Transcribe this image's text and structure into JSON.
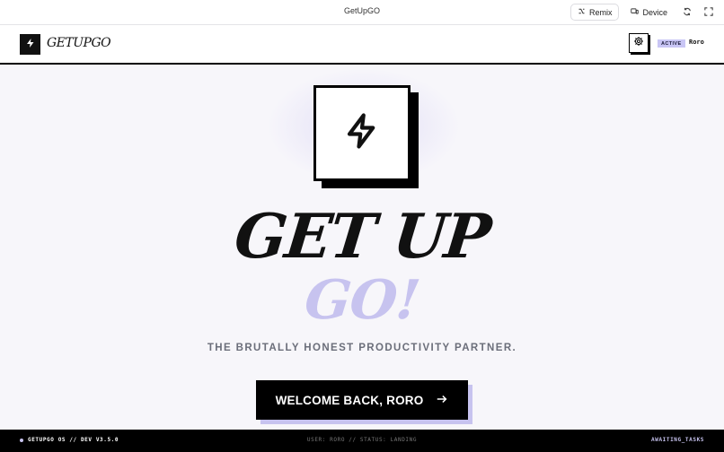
{
  "window": {
    "title": "GetUpGO",
    "remix_label": "Remix",
    "device_label": "Device"
  },
  "header": {
    "logo_text": "GETUPGO",
    "badge": "ACTIVE",
    "user": "Roro"
  },
  "hero": {
    "title": "GET UP",
    "subtitle": "GO!",
    "tagline": "THE BRUTALLY HONEST PRODUCTIVITY PARTNER.",
    "cta_label": "WELCOME BACK, RORO"
  },
  "footer": {
    "left": "GETUPGO OS // DEV V3.5.0",
    "middle": "USER: RORO // STATUS: LANDING",
    "right": "AWAITING_TASKS"
  },
  "colors": {
    "accent": "#c7c3ef",
    "primary": "#000000",
    "background": "#f7f6fa",
    "muted_text": "#6b6e7a"
  },
  "icons": {
    "logo": "lightning-icon",
    "settings": "gear-icon",
    "cta": "arrow-right-icon",
    "remix": "remix-icon",
    "device": "device-icon",
    "refresh": "refresh-icon",
    "fullscreen": "fullscreen-icon"
  }
}
